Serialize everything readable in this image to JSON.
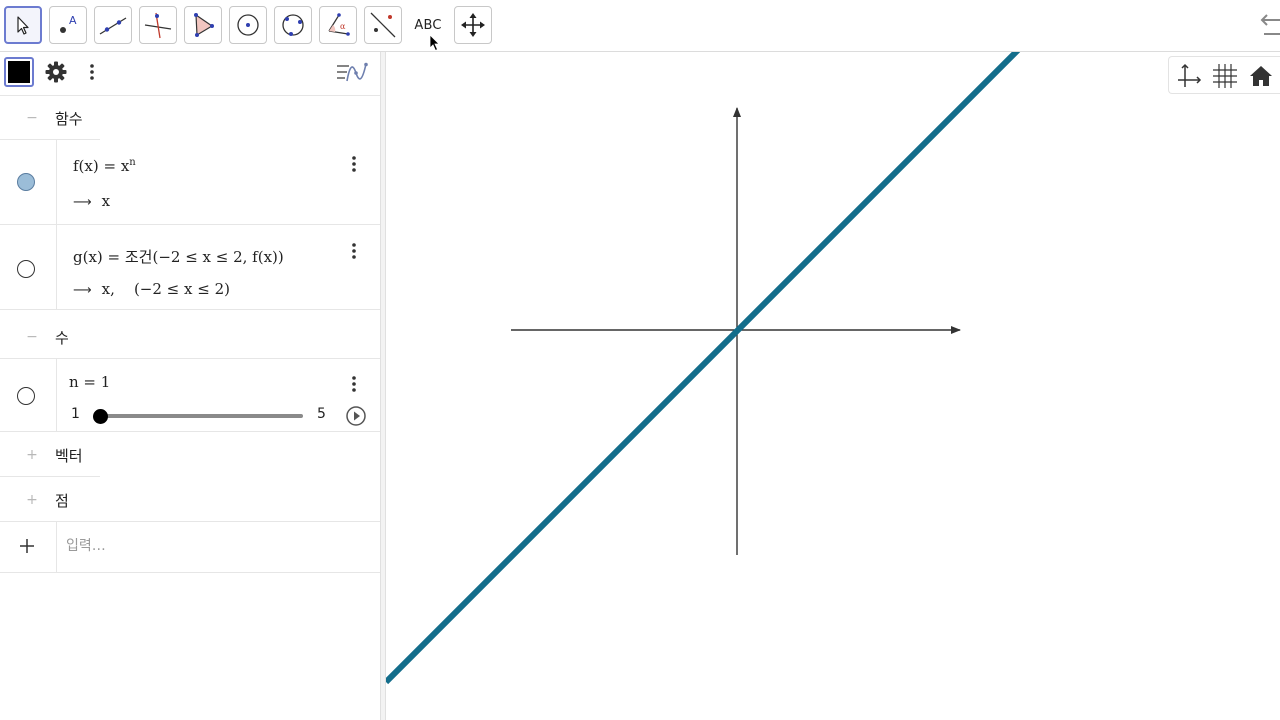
{
  "toolbar": {
    "tools": [
      {
        "name": "move-tool",
        "active": true
      },
      {
        "name": "point-tool"
      },
      {
        "name": "line-tool"
      },
      {
        "name": "perpendicular-line-tool"
      },
      {
        "name": "polygon-tool"
      },
      {
        "name": "circle-center-point-tool"
      },
      {
        "name": "circle-three-points-tool"
      },
      {
        "name": "angle-tool"
      },
      {
        "name": "reflect-about-line-tool"
      },
      {
        "name": "text-tool",
        "label": "ABC"
      },
      {
        "name": "move-graphics-view-tool"
      }
    ]
  },
  "algebra": {
    "header": {
      "swatch_color": "#000000"
    },
    "groups": {
      "functions": {
        "label": "함수",
        "toggle": "−"
      },
      "numbers": {
        "label": "수",
        "toggle": "−"
      },
      "vectors": {
        "label": "벡터",
        "toggle": "+"
      },
      "points": {
        "label": "점",
        "toggle": "+"
      }
    },
    "items": {
      "f": {
        "lhs": "f(x) = x",
        "exponent": "n",
        "arrow": "⟶",
        "output": "x",
        "visible": true
      },
      "g": {
        "formula": "g(x) = 조건(−2 ≤ x ≤ 2, f(x))",
        "arrow": "⟶",
        "output": "x,    (−2 ≤ x ≤ 2)",
        "visible": false
      },
      "n": {
        "formula": "n = 1",
        "slider_min": "1",
        "slider_max": "5",
        "value": 1,
        "visible": false
      }
    },
    "input": {
      "placeholder": "입력…",
      "value": ""
    }
  },
  "graphics": {
    "line_color": "#136d8b",
    "axes_color": "#333333",
    "view_buttons": [
      "axes-toggle",
      "grid-toggle",
      "home"
    ]
  }
}
